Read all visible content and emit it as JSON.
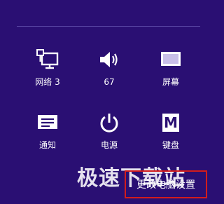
{
  "colors": {
    "background": "#2a0f73",
    "divider": "#5c4aa6",
    "highlight_border": "#d21c1c",
    "text": "#ffffff"
  },
  "tiles": [
    {
      "icon": "network-icon",
      "label": "网络 3"
    },
    {
      "icon": "volume-icon",
      "label": "67"
    },
    {
      "icon": "screen-icon",
      "label": "屏幕"
    },
    {
      "icon": "notifications-icon",
      "label": "通知"
    },
    {
      "icon": "power-icon",
      "label": "电源"
    },
    {
      "icon": "keyboard-icon",
      "label": "键盘"
    }
  ],
  "watermark": "极速下载站",
  "change_pc_settings": "更改电脑设置",
  "keyboard_glyph": "M"
}
